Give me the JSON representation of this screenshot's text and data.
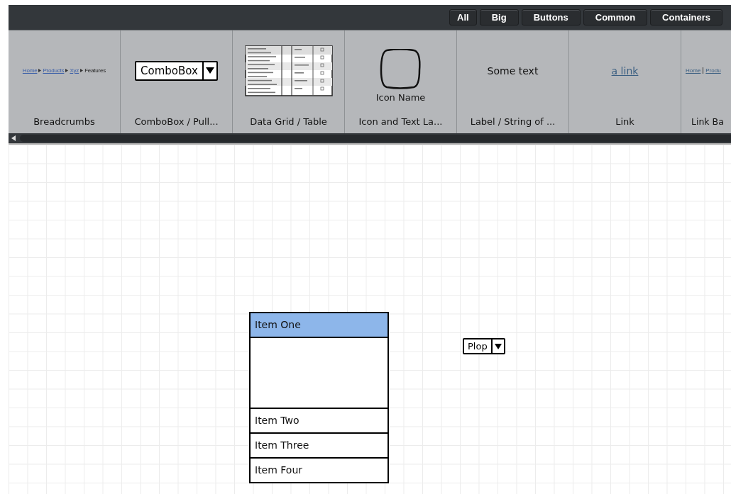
{
  "filter_buttons": [
    {
      "label": "All"
    },
    {
      "label": "Big"
    },
    {
      "label": "Buttons"
    },
    {
      "label": "Common"
    },
    {
      "label": "Containers"
    }
  ],
  "library": [
    {
      "kind": "breadcrumbs",
      "preview": {
        "items": [
          "Home",
          "Products",
          "Xyz",
          "Features"
        ]
      },
      "caption": "Breadcrumbs"
    },
    {
      "kind": "combobox",
      "preview": {
        "value": "ComboBox"
      },
      "caption": "ComboBox / Pull..."
    },
    {
      "kind": "datagrid",
      "caption": "Data Grid / Table"
    },
    {
      "kind": "icon",
      "preview": {
        "label": "Icon Name"
      },
      "caption": "Icon and Text La..."
    },
    {
      "kind": "label",
      "preview": {
        "text": "Some text"
      },
      "caption": "Label / String of ..."
    },
    {
      "kind": "link",
      "preview": {
        "text": "a link"
      },
      "caption": "Link"
    },
    {
      "kind": "linkbar",
      "preview": {
        "items": [
          "Home",
          "Produ"
        ]
      },
      "caption": "Link Ba"
    }
  ],
  "canvas": {
    "list": {
      "items": [
        {
          "kind": "row",
          "label": "Item One",
          "selected": true
        },
        {
          "kind": "gap"
        },
        {
          "kind": "row",
          "label": "Item Two",
          "selected": false
        },
        {
          "kind": "row",
          "label": "Item Three",
          "selected": false
        },
        {
          "kind": "row",
          "label": "Item Four",
          "selected": false
        }
      ]
    },
    "combobox": {
      "value": "Plop"
    }
  }
}
